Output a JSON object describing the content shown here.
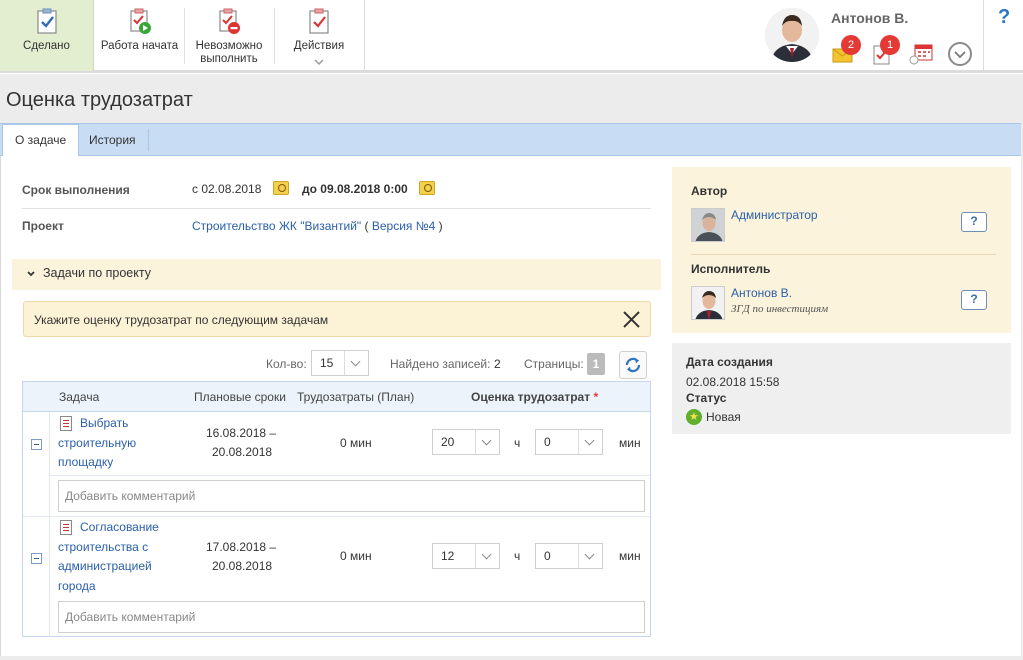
{
  "toolbar": {
    "done_label": "Сделано",
    "started_label": "Работа начата",
    "impossible_label_1": "Невозможно",
    "impossible_label_2": "выполнить",
    "actions_label": "Действия"
  },
  "user": {
    "name": "Антонов В.",
    "mail_badge": "2",
    "tasks_badge": "1"
  },
  "help": "?",
  "page_title": "Оценка трудозатрат",
  "tabs": [
    {
      "label": "О задаче",
      "active": true
    },
    {
      "label": "История",
      "active": false
    }
  ],
  "details": {
    "deadline_label": "Срок выполнения",
    "deadline_from": "с 02.08.2018",
    "deadline_to": "до 09.08.2018 0:00",
    "project_label": "Проект",
    "project_name": "Строительство ЖК \"Византий\"",
    "project_paren_open": "(",
    "project_version": "Версия №4",
    "project_paren_close": ")"
  },
  "section_title": "Задачи по проекту",
  "warning": "Укажите оценку трудозатрат по следующим задачам",
  "pager": {
    "count_label": "Кол-во:",
    "count_value": "15",
    "found_label": "Найдено записей:",
    "found_value": "2",
    "pages_label": "Страницы:",
    "page_current": "1"
  },
  "table": {
    "headers": {
      "task": "Задача",
      "planned": "Плановые сроки",
      "effort_plan": "Трудозатраты (План)",
      "estimate": "Оценка трудозатрат",
      "required_mark": "*"
    },
    "hours_unit": "ч",
    "minutes_unit": "мин",
    "comment_placeholder": "Добавить комментарий",
    "rows": [
      {
        "task_lines": [
          "Выбрать",
          "строительную",
          "площадку"
        ],
        "planned_from": "16.08.2018 –",
        "planned_to": "20.08.2018",
        "effort_plan": "0 мин",
        "hours": "20",
        "minutes": "0"
      },
      {
        "task_lines": [
          "Согласование",
          "строительства с",
          "администрацией",
          "города"
        ],
        "planned_from": "17.08.2018 –",
        "planned_to": "20.08.2018",
        "effort_plan": "0 мин",
        "hours": "12",
        "minutes": "0"
      }
    ]
  },
  "side": {
    "author_label": "Автор",
    "author_name": "Администратор",
    "assignee_label": "Исполнитель",
    "assignee_name": "Антонов В.",
    "assignee_role": "ЗГД по инвестициям",
    "created_label": "Дата создания",
    "created_value": "02.08.2018 15:58",
    "status_label": "Статус",
    "status_value": "Новая"
  }
}
